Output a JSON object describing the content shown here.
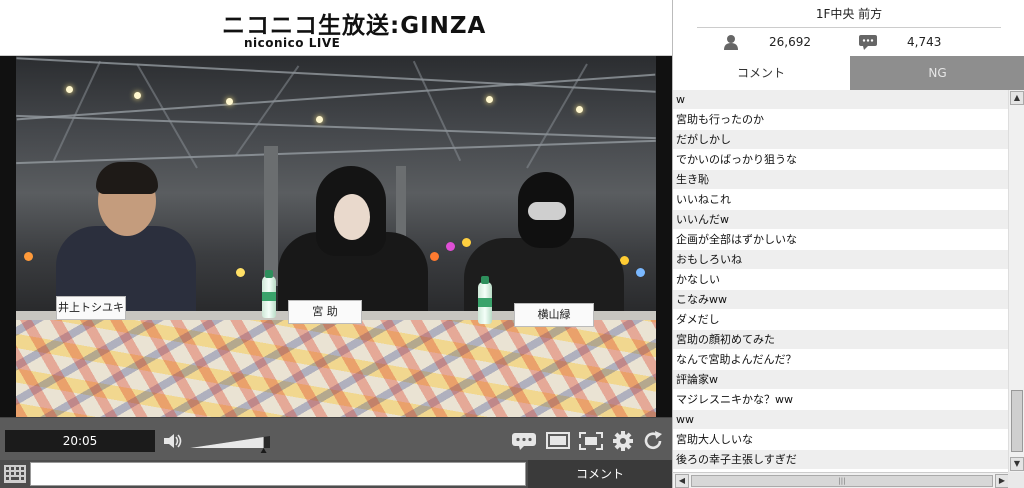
{
  "header": {
    "logo_main": "ニコニコ生放送:GINZA",
    "logo_sub": "niconico LIVE"
  },
  "player": {
    "time": "20:05",
    "volume_fraction": 0.92,
    "nameplates": [
      "井上トシユキ",
      "宮 助",
      "横山緑"
    ],
    "comment_placeholder": "",
    "comment_submit_label": "コメント"
  },
  "info": {
    "seat": "1F中央 前方",
    "viewers": "26,692",
    "comments": "4,743"
  },
  "tabs": {
    "comment": "コメント",
    "ng": "NG"
  },
  "comments": [
    "w",
    "宮助も行ったのか",
    "だがしかし",
    "でかいのばっかり狙うな",
    "生き恥",
    "いいねこれ",
    "いいんだw",
    "企画が全部はずかしいな",
    "おもしろいね",
    "かなしい",
    "こなみww",
    "ダメだし",
    "宮助の顔初めてみた",
    "なんで宮助よんだんだ？",
    "評論家w",
    "マジレスニキかな？ww",
    "ww",
    "宮助大人しいな",
    "後ろの幸子主張しすぎだ"
  ],
  "colors": {
    "control_bar": "#5b5b5b",
    "time_display": "#1b1b1b",
    "tab_inactive": "#8e8e8e",
    "row_alt": "#eeeeee"
  },
  "icons": {
    "viewers": "person-icon",
    "comments": "speech-bubble-icon",
    "volume": "speaker-icon",
    "controls": [
      "comment-toggle-icon",
      "screen-icon",
      "fullscreen-icon",
      "gear-icon",
      "reload-icon"
    ],
    "input": "keyboard-icon"
  }
}
